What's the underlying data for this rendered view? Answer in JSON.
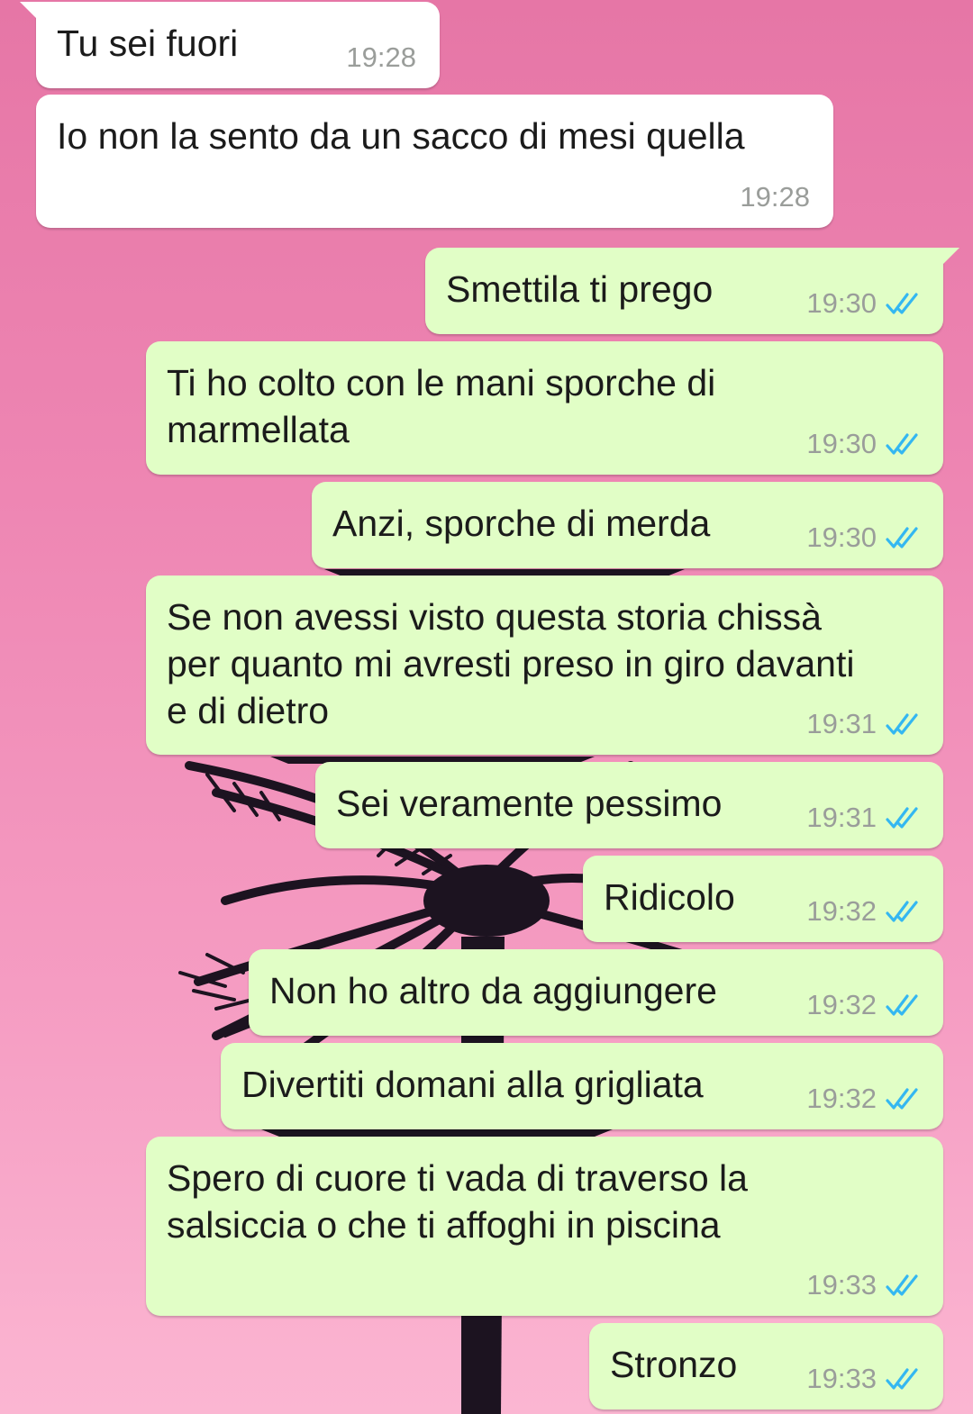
{
  "chat": {
    "messages": [
      {
        "id": "m1",
        "direction": "incoming",
        "text": "Tu sei fuori",
        "time": "19:28"
      },
      {
        "id": "m2",
        "direction": "incoming",
        "text": "Io non la sento da un sacco di mesi quella",
        "time": "19:28"
      },
      {
        "id": "m3",
        "direction": "outgoing",
        "text": "Smettila ti prego",
        "time": "19:30",
        "status_icon": "double-check-read-icon"
      },
      {
        "id": "m4",
        "direction": "outgoing",
        "text": "Ti ho colto con le mani sporche di\nmarmellata",
        "time": "19:30",
        "status_icon": "double-check-read-icon"
      },
      {
        "id": "m5",
        "direction": "outgoing",
        "text": "Anzi, sporche di merda",
        "time": "19:30",
        "status_icon": "double-check-read-icon"
      },
      {
        "id": "m6",
        "direction": "outgoing",
        "text": "Se non avessi visto questa storia chissà\nper quanto mi avresti preso in giro davanti\ne di dietro",
        "time": "19:31",
        "status_icon": "double-check-read-icon"
      },
      {
        "id": "m7",
        "direction": "outgoing",
        "text": "Sei veramente pessimo",
        "time": "19:31",
        "status_icon": "double-check-read-icon"
      },
      {
        "id": "m8",
        "direction": "outgoing",
        "text": "Ridicolo",
        "time": "19:32",
        "status_icon": "double-check-read-icon"
      },
      {
        "id": "m9",
        "direction": "outgoing",
        "text": "Non ho altro da aggiungere",
        "time": "19:32",
        "status_icon": "double-check-read-icon"
      },
      {
        "id": "m10",
        "direction": "outgoing",
        "text": "Divertiti domani alla grigliata",
        "time": "19:32",
        "status_icon": "double-check-read-icon"
      },
      {
        "id": "m11",
        "direction": "outgoing",
        "text": "Spero di cuore ti vada di traverso la\nsalsiccia o che ti affoghi in piscina",
        "time": "19:33",
        "status_icon": "double-check-read-icon"
      },
      {
        "id": "m12",
        "direction": "outgoing",
        "text": "Stronzo",
        "time": "19:33",
        "status_icon": "double-check-read-icon"
      }
    ]
  },
  "colors": {
    "incoming_bubble": "#ffffff",
    "outgoing_bubble": "#e1fec6",
    "read_ticks": "#34b7f1",
    "wallpaper_top": "#e676a6",
    "wallpaper_bottom": "#fbb6d2",
    "palm_silhouette": "#1c1320"
  }
}
